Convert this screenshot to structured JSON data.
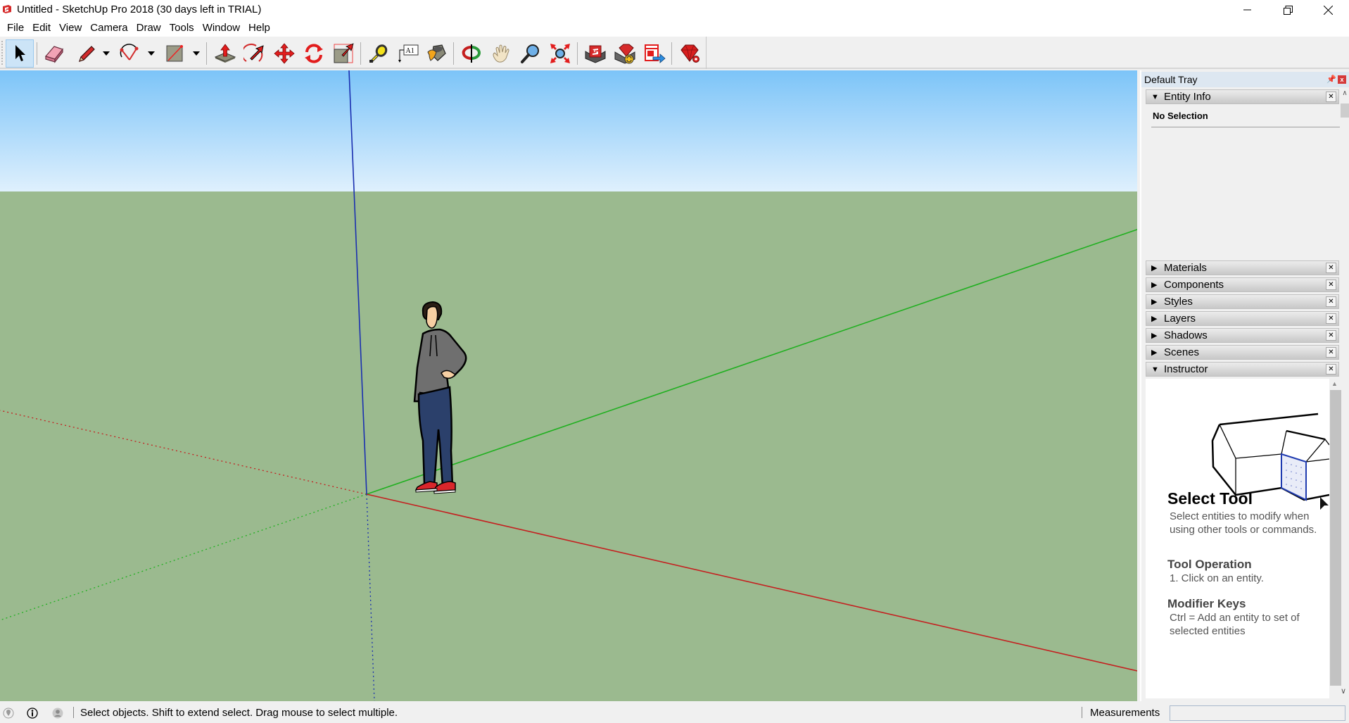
{
  "window": {
    "title": "Untitled - SketchUp Pro 2018 (30 days left in TRIAL)",
    "controls": [
      "minimize",
      "restore",
      "close"
    ]
  },
  "menu": {
    "items": [
      "File",
      "Edit",
      "View",
      "Camera",
      "Draw",
      "Tools",
      "Window",
      "Help"
    ]
  },
  "toolbar": {
    "tools": [
      {
        "name": "Select",
        "icon": "select-arrow-icon",
        "active": true
      },
      {
        "name": "Eraser",
        "icon": "eraser-icon"
      },
      {
        "name": "Line",
        "icon": "pencil-icon",
        "dropdown": true
      },
      {
        "name": "Arc",
        "icon": "arc-icon",
        "dropdown": true
      },
      {
        "name": "Rectangle",
        "icon": "rectangle-icon",
        "dropdown": true
      },
      {
        "name": "Push/Pull",
        "icon": "push-pull-icon"
      },
      {
        "name": "Offset",
        "icon": "offset-icon"
      },
      {
        "name": "Move",
        "icon": "move-icon"
      },
      {
        "name": "Rotate",
        "icon": "rotate-icon"
      },
      {
        "name": "Scale",
        "icon": "scale-icon"
      },
      {
        "name": "Tape Measure",
        "icon": "tape-measure-icon"
      },
      {
        "name": "Text",
        "icon": "text-icon",
        "glyph": "A1"
      },
      {
        "name": "Paint Bucket",
        "icon": "paint-bucket-icon"
      },
      {
        "name": "Orbit",
        "icon": "orbit-icon"
      },
      {
        "name": "Pan",
        "icon": "pan-hand-icon"
      },
      {
        "name": "Zoom",
        "icon": "zoom-icon"
      },
      {
        "name": "Zoom Extents",
        "icon": "zoom-extents-icon"
      },
      {
        "name": "3D Warehouse",
        "icon": "warehouse-icon"
      },
      {
        "name": "Extension Warehouse",
        "icon": "extension-warehouse-icon"
      },
      {
        "name": "Send to LayOut",
        "icon": "send-to-layout-icon"
      },
      {
        "name": "Extension Manager",
        "icon": "ruby-gem-icon"
      }
    ]
  },
  "viewport": {
    "sky_color_top": "#7cc4f8",
    "sky_color_bottom": "#dff0fd",
    "ground_color": "#9bba8f",
    "axes": {
      "red": "#c42020",
      "green": "#20b020",
      "blue": "#1a2fb0"
    },
    "figure": "scale-figure-person"
  },
  "tray": {
    "title": "Default Tray",
    "entity_info": {
      "label": "Entity Info",
      "status": "No Selection",
      "expanded": true
    },
    "panels": [
      {
        "label": "Materials",
        "expanded": false
      },
      {
        "label": "Components",
        "expanded": false
      },
      {
        "label": "Styles",
        "expanded": false
      },
      {
        "label": "Layers",
        "expanded": false
      },
      {
        "label": "Shadows",
        "expanded": false
      },
      {
        "label": "Scenes",
        "expanded": false
      },
      {
        "label": "Instructor",
        "expanded": true
      }
    ],
    "instructor": {
      "heading": "Select Tool",
      "description": "Select entities to modify when using other tools or commands.",
      "section1_title": "Tool Operation",
      "section1_text": "1. Click on an entity.",
      "section2_title": "Modifier Keys",
      "section2_text": "Ctrl = Add an entity to set of selected entities"
    }
  },
  "status": {
    "message": "Select objects. Shift to extend select. Drag mouse to select multiple.",
    "measurements_label": "Measurements",
    "measurements_value": ""
  }
}
